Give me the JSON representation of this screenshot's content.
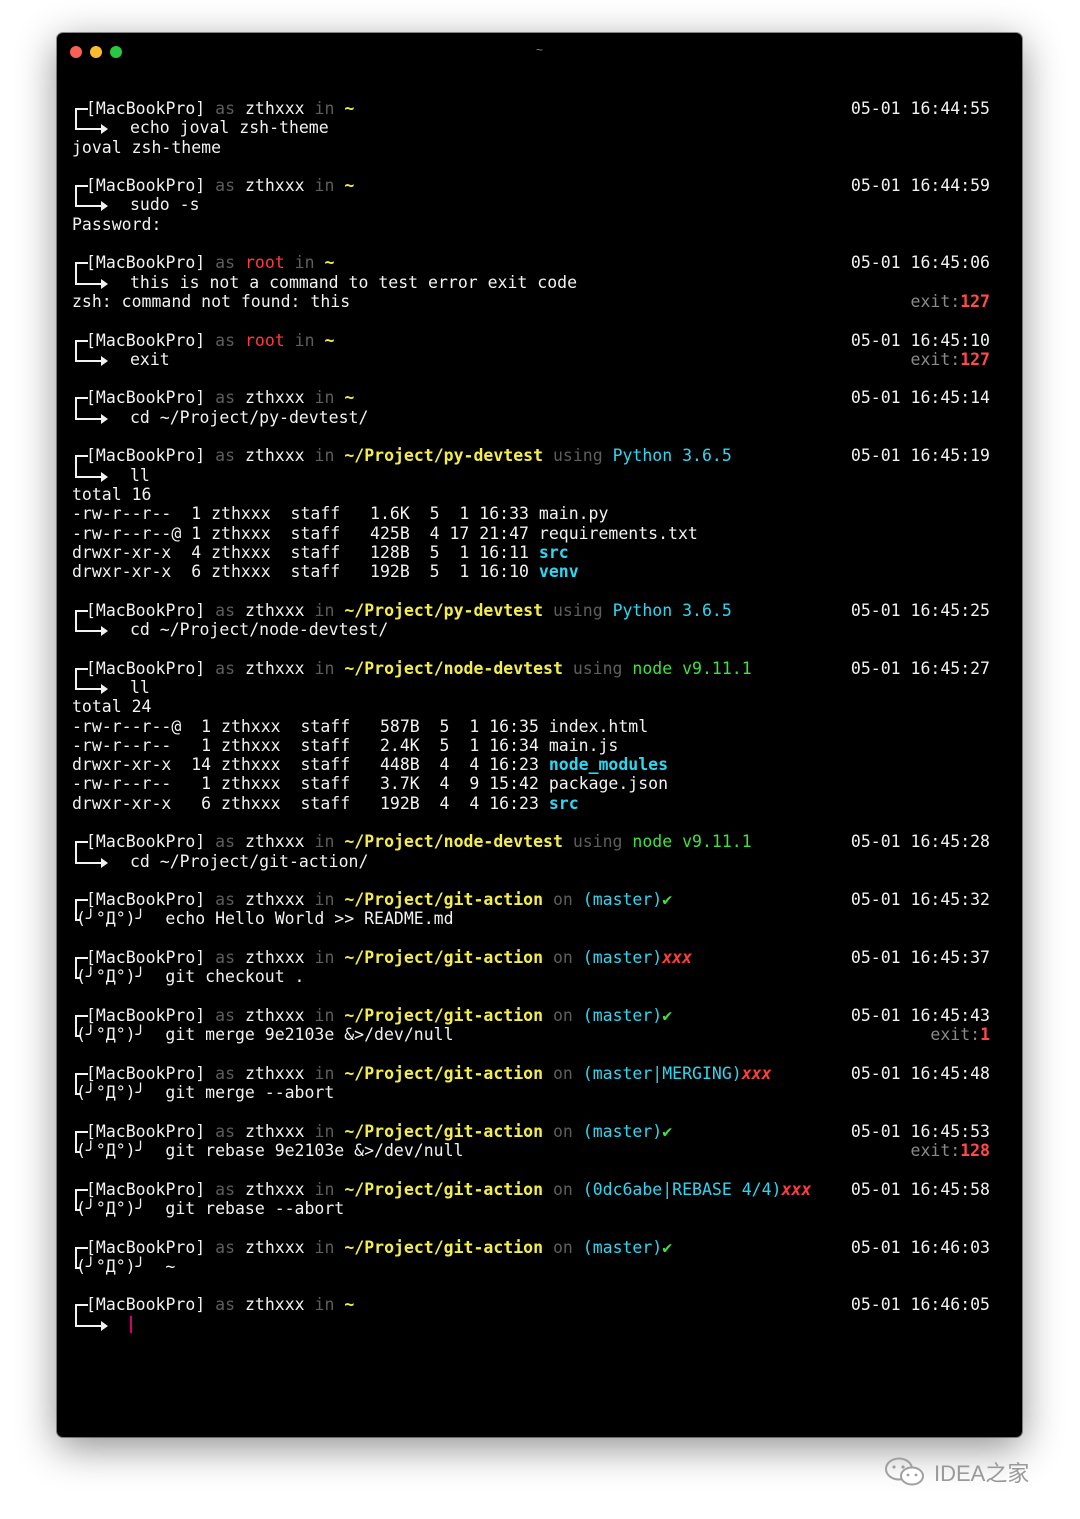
{
  "window": {
    "title": "~"
  },
  "terminal": {
    "blocks": [
      {
        "host": "[MacBookPro]",
        "as": "as",
        "user": "zthxxx",
        "in": "in",
        "dir": "~",
        "time": "05-01 16:44:55",
        "prompt": "",
        "command": "echo joval zsh-theme",
        "output": [
          "joval zsh-theme"
        ]
      },
      {
        "host": "[MacBookPro]",
        "as": "as",
        "user": "zthxxx",
        "in": "in",
        "dir": "~",
        "time": "05-01 16:44:59",
        "prompt": "",
        "command": "sudo -s",
        "output": [
          "Password:"
        ]
      },
      {
        "host": "[MacBookPro]",
        "as": "as",
        "user": "root",
        "in": "in",
        "dir": "~",
        "time": "05-01 16:45:06",
        "prompt": "",
        "command": "this is not a command to test error exit code",
        "output": [
          "zsh: command not found: this"
        ],
        "exit_label": "exit:",
        "exit_code": "127"
      },
      {
        "host": "[MacBookPro]",
        "as": "as",
        "user": "root",
        "in": "in",
        "dir": "~",
        "time": "05-01 16:45:10",
        "prompt": "",
        "command": "exit",
        "exit_label": "exit:",
        "exit_code": "127"
      },
      {
        "host": "[MacBookPro]",
        "as": "as",
        "user": "zthxxx",
        "in": "in",
        "dir": "~",
        "time": "05-01 16:45:14",
        "prompt": "",
        "command": "cd ~/Project/py-devtest/"
      },
      {
        "host": "[MacBookPro]",
        "as": "as",
        "user": "zthxxx",
        "in": "in",
        "dir": "~/Project/py-devtest",
        "using": "using",
        "env": "Python 3.6.5",
        "time": "05-01 16:45:19",
        "prompt": "",
        "command": "ll",
        "total": "total 16",
        "listing": [
          {
            "text": "-rw-r--r--  1 zthxxx  staff   1.6K  5  1 16:33 ",
            "name": "main.py",
            "dir": false
          },
          {
            "text": "-rw-r--r--@ 1 zthxxx  staff   425B  4 17 21:47 ",
            "name": "requirements.txt",
            "dir": false
          },
          {
            "text": "drwxr-xr-x  4 zthxxx  staff   128B  5  1 16:11 ",
            "name": "src",
            "dir": true
          },
          {
            "text": "drwxr-xr-x  6 zthxxx  staff   192B  5  1 16:10 ",
            "name": "venv",
            "dir": true
          }
        ]
      },
      {
        "host": "[MacBookPro]",
        "as": "as",
        "user": "zthxxx",
        "in": "in",
        "dir": "~/Project/py-devtest",
        "using": "using",
        "env": "Python 3.6.5",
        "time": "05-01 16:45:25",
        "prompt": "",
        "command": "cd ~/Project/node-devtest/"
      },
      {
        "host": "[MacBookPro]",
        "as": "as",
        "user": "zthxxx",
        "in": "in",
        "dir": "~/Project/node-devtest",
        "using": "using",
        "env": "node v9.11.1",
        "time": "05-01 16:45:27",
        "prompt": "",
        "command": "ll",
        "total": "total 24",
        "listing": [
          {
            "text": "-rw-r--r--@  1 zthxxx  staff   587B  5  1 16:35 ",
            "name": "index.html",
            "dir": false
          },
          {
            "text": "-rw-r--r--   1 zthxxx  staff   2.4K  5  1 16:34 ",
            "name": "main.js",
            "dir": false
          },
          {
            "text": "drwxr-xr-x  14 zthxxx  staff   448B  4  4 16:23 ",
            "name": "node_modules",
            "dir": true
          },
          {
            "text": "-rw-r--r--   1 zthxxx  staff   3.7K  4  9 15:42 ",
            "name": "package.json",
            "dir": false
          },
          {
            "text": "drwxr-xr-x   6 zthxxx  staff   192B  4  4 16:23 ",
            "name": "src",
            "dir": true
          }
        ]
      },
      {
        "host": "[MacBookPro]",
        "as": "as",
        "user": "zthxxx",
        "in": "in",
        "dir": "~/Project/node-devtest",
        "using": "using",
        "env": "node v9.11.1",
        "time": "05-01 16:45:28",
        "prompt": "",
        "command": "cd ~/Project/git-action/"
      },
      {
        "host": "[MacBookPro]",
        "as": "as",
        "user": "zthxxx",
        "in": "in",
        "dir": "~/Project/git-action",
        "on": "on",
        "branch": "(master)",
        "status": "✔",
        "dirty": false,
        "time": "05-01 16:45:32",
        "prompt": "(╯°Д°)╯",
        "command": "echo Hello World >> README.md"
      },
      {
        "host": "[MacBookPro]",
        "as": "as",
        "user": "zthxxx",
        "in": "in",
        "dir": "~/Project/git-action",
        "on": "on",
        "branch": "(master)",
        "status": "xxx",
        "dirty": true,
        "time": "05-01 16:45:37",
        "prompt": "(╯°Д°)╯",
        "command": "git checkout ."
      },
      {
        "host": "[MacBookPro]",
        "as": "as",
        "user": "zthxxx",
        "in": "in",
        "dir": "~/Project/git-action",
        "on": "on",
        "branch": "(master)",
        "status": "✔",
        "dirty": false,
        "time": "05-01 16:45:43",
        "prompt": "(╯°Д°)╯",
        "command": "git merge 9e2103e &>/dev/null",
        "exit_label": "exit:",
        "exit_code": "1"
      },
      {
        "host": "[MacBookPro]",
        "as": "as",
        "user": "zthxxx",
        "in": "in",
        "dir": "~/Project/git-action",
        "on": "on",
        "branch": "(master|MERGING)",
        "status": "xxx",
        "dirty": true,
        "time": "05-01 16:45:48",
        "prompt": "(╯°Д°)╯",
        "command": "git merge --abort"
      },
      {
        "host": "[MacBookPro]",
        "as": "as",
        "user": "zthxxx",
        "in": "in",
        "dir": "~/Project/git-action",
        "on": "on",
        "branch": "(master)",
        "status": "✔",
        "dirty": false,
        "time": "05-01 16:45:53",
        "prompt": "(╯°Д°)╯",
        "command": "git rebase 9e2103e &>/dev/null",
        "exit_label": "exit:",
        "exit_code": "128"
      },
      {
        "host": "[MacBookPro]",
        "as": "as",
        "user": "zthxxx",
        "in": "in",
        "dir": "~/Project/git-action",
        "on": "on",
        "branch": "(0dc6abe|REBASE 4/4)",
        "status": "xxx",
        "dirty": true,
        "time": "05-01 16:45:58",
        "prompt": "(╯°Д°)╯",
        "command": "git rebase --abort"
      },
      {
        "host": "[MacBookPro]",
        "as": "as",
        "user": "zthxxx",
        "in": "in",
        "dir": "~/Project/git-action",
        "on": "on",
        "branch": "(master)",
        "status": "✔",
        "dirty": false,
        "time": "05-01 16:46:03",
        "prompt": "(╯°Д°)╯",
        "command": "~"
      },
      {
        "host": "[MacBookPro]",
        "as": "as",
        "user": "zthxxx",
        "in": "in",
        "dir": "~",
        "time": "05-01 16:46:05",
        "prompt": "",
        "command": "",
        "cursor": true
      }
    ]
  },
  "watermark": {
    "icon": "wechat-icon",
    "text": "IDEA之家"
  }
}
